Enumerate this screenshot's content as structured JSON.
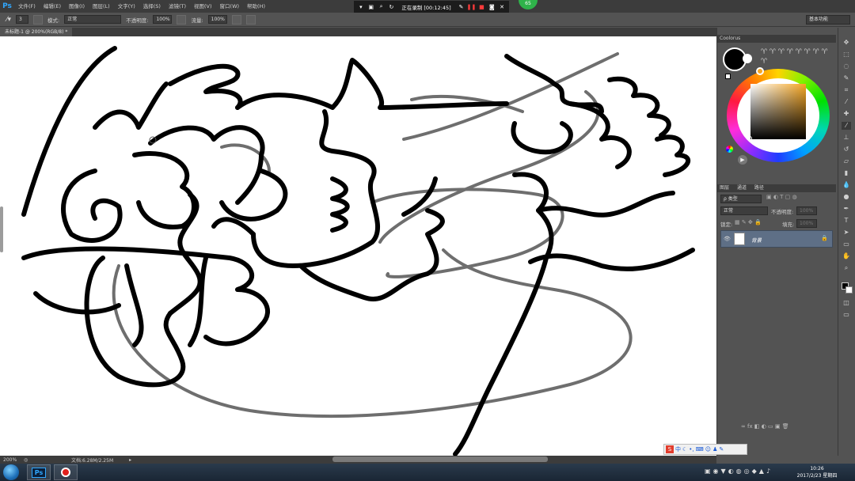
{
  "app": {
    "logo": "Ps"
  },
  "menu": [
    "文件(F)",
    "编辑(E)",
    "图像(I)",
    "图层(L)",
    "文字(Y)",
    "选择(S)",
    "滤镜(T)",
    "视图(V)",
    "窗口(W)",
    "帮助(H)"
  ],
  "recording": {
    "status": "正在录制 [00:12:45]"
  },
  "badge": {
    "label": "65"
  },
  "options": {
    "brush_size": "3",
    "mode_label": "模式:",
    "mode_value": "正常",
    "opacity_label": "不透明度:",
    "opacity_value": "100%",
    "flow_label": "流量:",
    "flow_value": "100%"
  },
  "workspace": "基本功能",
  "document": {
    "tab": "未标题-1 @ 200%(RGB/8) *"
  },
  "status": {
    "zoom": "200%",
    "doc_size": "文档:6.28M/2.25M"
  },
  "color_panel": {
    "title": "Coolorus"
  },
  "layers_panel": {
    "tabs": [
      "图层",
      "通道",
      "路径"
    ],
    "filter": "ρ 类型",
    "blend_mode": "正常",
    "opacity_label": "不透明度:",
    "opacity_value": "100%",
    "lock_label": "锁定:",
    "fill_label": "填充:",
    "fill_value": "100%",
    "layers": [
      {
        "name": "背景"
      }
    ]
  },
  "ime": {
    "label": "中"
  },
  "taskbar": {
    "ps_label": "Ps",
    "time": "10:26",
    "date": "2017/2/23 星期四"
  }
}
